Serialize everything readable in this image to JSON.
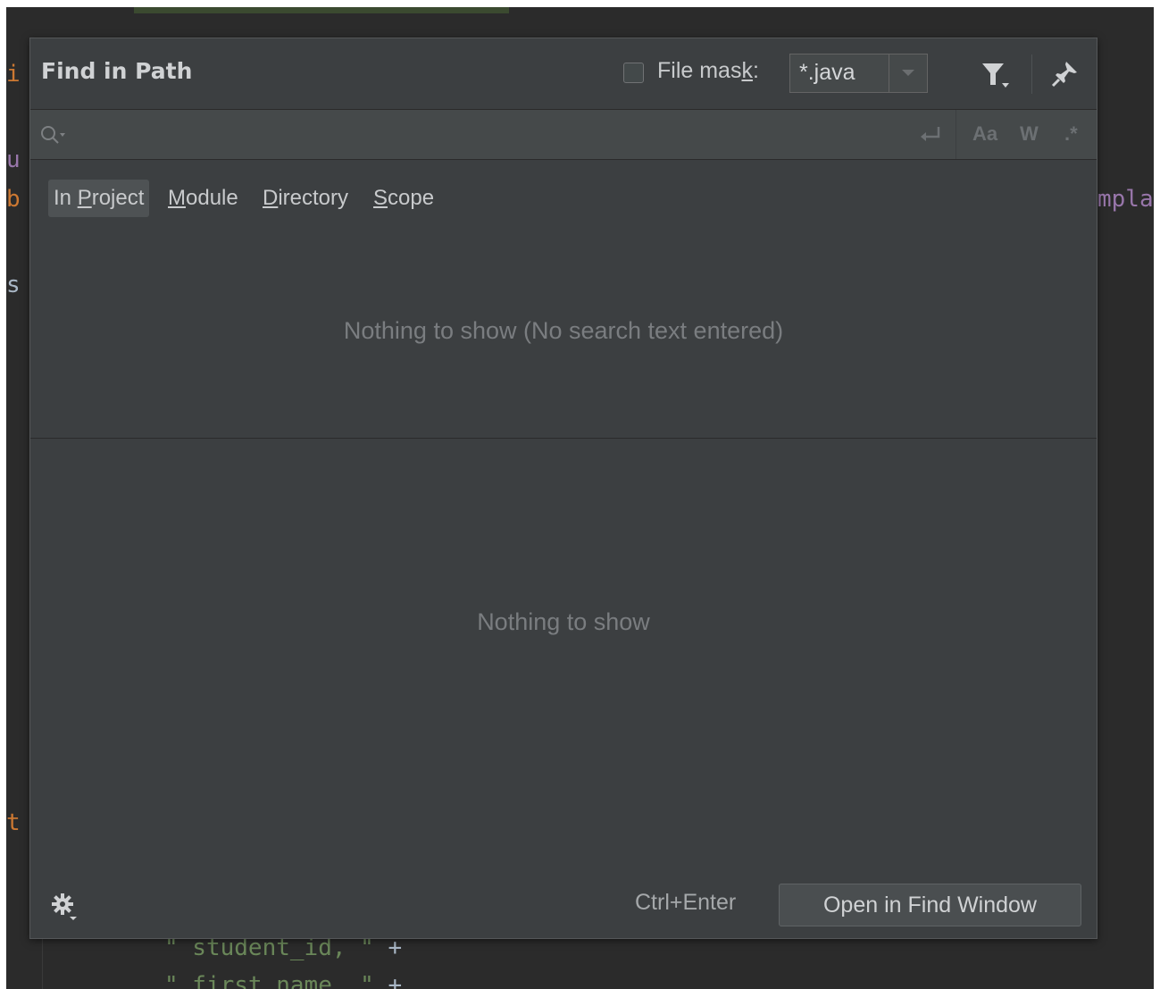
{
  "editor": {
    "line1": "i",
    "line2": "u",
    "line3": "b",
    "line3_right": "mpla",
    "line4": "s",
    "line5": "t",
    "code_student_id_quote1": "\"",
    "code_student_id": " student_id, ",
    "code_student_id_quote2": "\"",
    "code_plus1": " +",
    "code_first_name_quote1": "\"",
    "code_first_name": " first_name, ",
    "code_first_name_quote2": "\"",
    "code_plus2": " +"
  },
  "dialog": {
    "title": "Find in Path",
    "file_mask": {
      "label_before": "File mas",
      "label_underlined": "k",
      "label_after": ":",
      "checked": false,
      "value": "*.java"
    },
    "search": {
      "value": "",
      "options": {
        "match_case": "Aa",
        "words": "W",
        "regex": ".*"
      }
    },
    "scope_tabs": [
      {
        "pre": "In ",
        "u": "P",
        "post": "roject",
        "selected": true
      },
      {
        "pre": "",
        "u": "M",
        "post": "odule",
        "selected": false
      },
      {
        "pre": "",
        "u": "D",
        "post": "irectory",
        "selected": false
      },
      {
        "pre": "",
        "u": "S",
        "post": "cope",
        "selected": false
      }
    ],
    "results_empty": "Nothing to show (No search text entered)",
    "preview_empty": "Nothing to show",
    "shortcut": "Ctrl+Enter",
    "open_button": "Open in Find Window"
  },
  "icons": {
    "search": "search-icon",
    "filter": "filter-icon",
    "pin": "pin-icon",
    "newline": "newline-icon",
    "settings": "gear-icon"
  },
  "colors": {
    "dialog_bg": "#3c3f41",
    "editor_bg": "#2b2b2b",
    "keyword": "#cc7832",
    "string": "#6a8759"
  }
}
